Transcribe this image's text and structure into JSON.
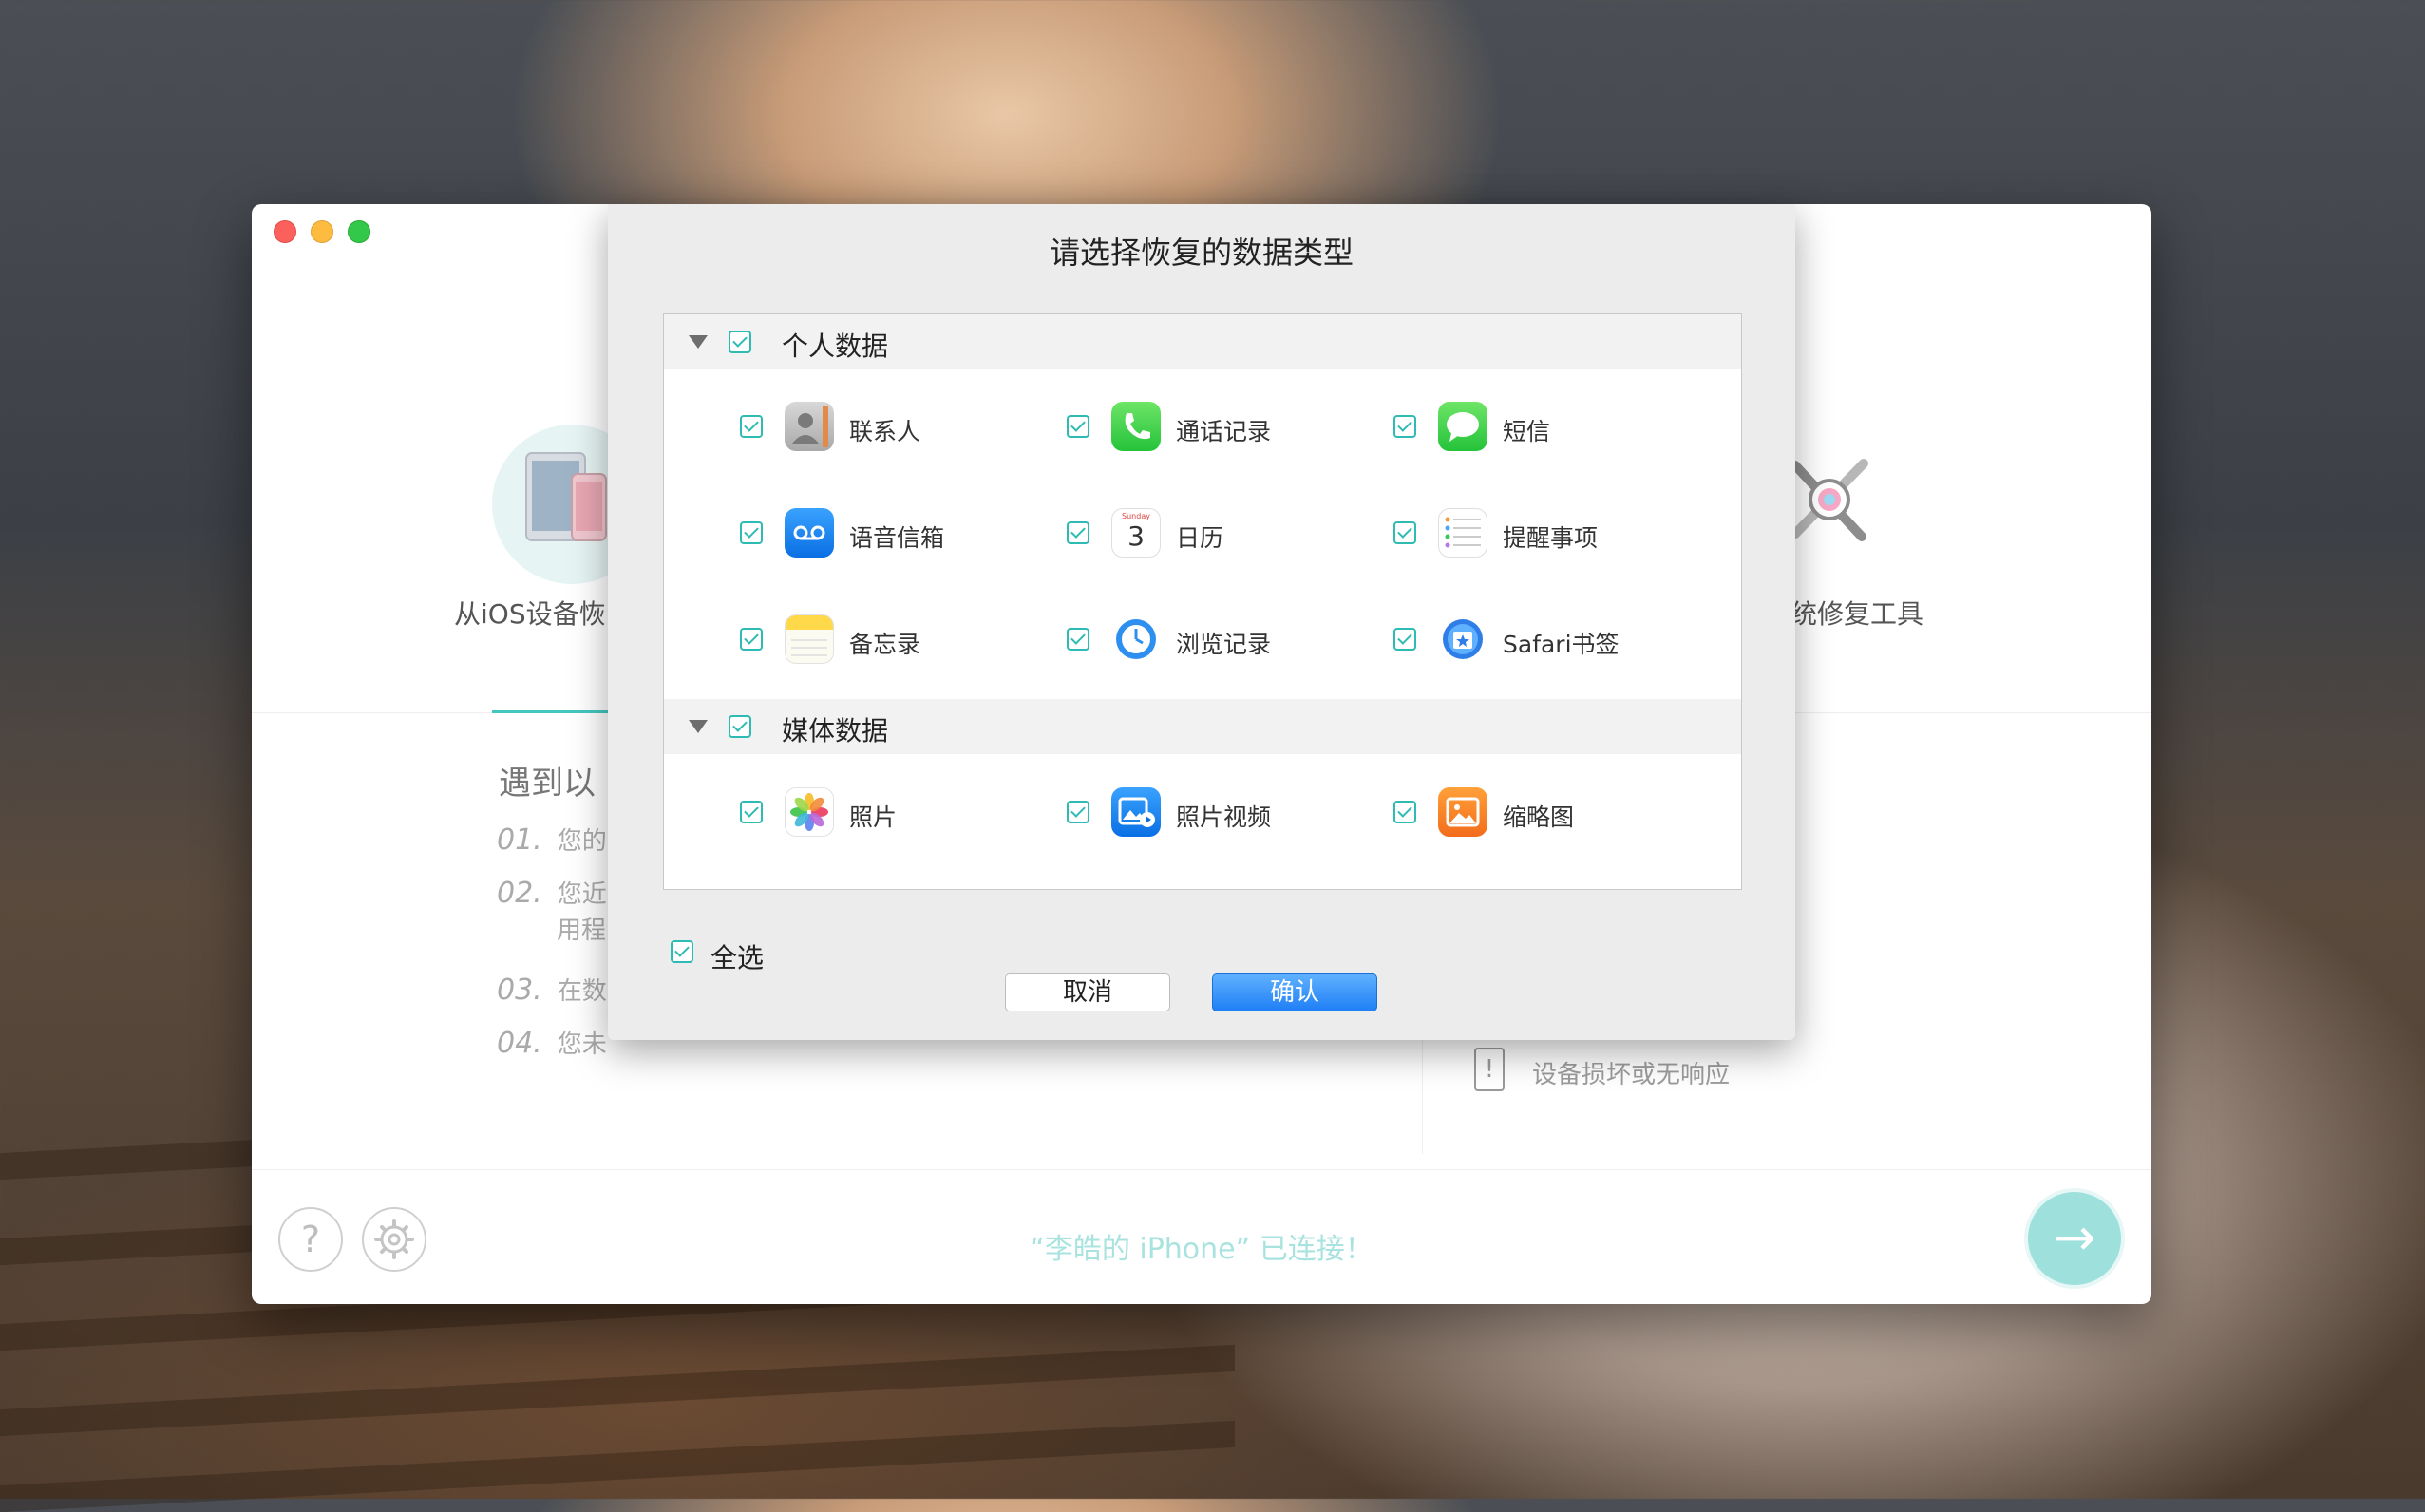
{
  "dialog": {
    "title": "请选择恢复的数据类型",
    "groups": [
      {
        "label": "个人数据",
        "items": [
          {
            "label": "联系人",
            "icon": "contacts-icon"
          },
          {
            "label": "通话记录",
            "icon": "phone-icon"
          },
          {
            "label": "短信",
            "icon": "messages-icon"
          },
          {
            "label": "语音信箱",
            "icon": "voicemail-icon"
          },
          {
            "label": "日历",
            "icon": "calendar-icon",
            "calendar_day": "Sunday",
            "calendar_date": "3"
          },
          {
            "label": "提醒事项",
            "icon": "reminders-icon"
          },
          {
            "label": "备忘录",
            "icon": "notes-icon"
          },
          {
            "label": "浏览记录",
            "icon": "history-icon"
          },
          {
            "label": "Safari书签",
            "icon": "safari-bookmarks-icon"
          }
        ]
      },
      {
        "label": "媒体数据",
        "items": [
          {
            "label": "照片",
            "icon": "photos-icon"
          },
          {
            "label": "照片视频",
            "icon": "photo-video-icon"
          },
          {
            "label": "缩略图",
            "icon": "thumbnails-icon"
          }
        ]
      }
    ],
    "select_all_label": "全选",
    "cancel_label": "取消",
    "confirm_label": "确认"
  },
  "main": {
    "mode_left_label": "从iOS设备恢",
    "mode_right_label": "统修复工具",
    "scenarios_title": "遇到以",
    "scenarios": [
      {
        "num": "01.",
        "text": "您的"
      },
      {
        "num": "02.",
        "text": "您近",
        "text2": "用程"
      },
      {
        "num": "03.",
        "text": "在数"
      },
      {
        "num": "04.",
        "text": "您未"
      }
    ],
    "damage_label": "设备损坏或无响应",
    "status_text": "“李皓的 iPhone” 已连接！"
  },
  "colors": {
    "accent": "#2ebbb3",
    "confirm_blue": "#1f7ff5",
    "status_text": "#a8e3df",
    "next_button": "#9ee0dc"
  }
}
